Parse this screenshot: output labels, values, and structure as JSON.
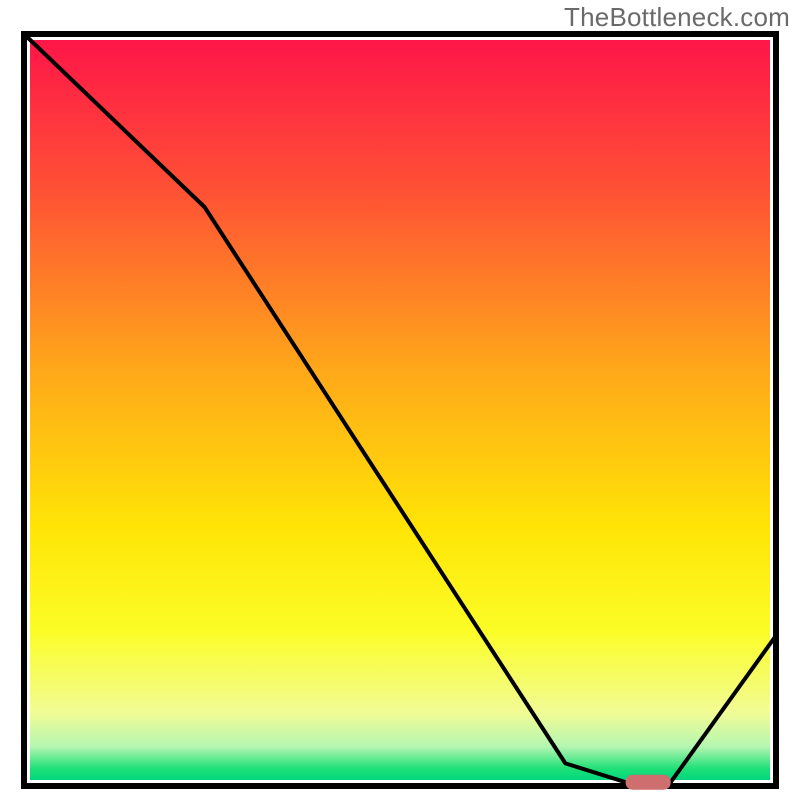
{
  "watermark": "TheBottleneck.com",
  "chart_data": {
    "type": "line",
    "title": "",
    "xlabel": "",
    "ylabel": "",
    "xlim": [
      0,
      100
    ],
    "ylim": [
      0,
      100
    ],
    "grid": false,
    "legend": false,
    "series": [
      {
        "name": "curve",
        "x": [
          0,
          24,
          72,
          80,
          86,
          100
        ],
        "values": [
          100,
          77,
          3,
          0.5,
          0.5,
          20
        ]
      }
    ],
    "marker": {
      "x_start": 80,
      "x_end": 86,
      "y": 0.5,
      "color": "#cf6e6e"
    },
    "background_gradient": {
      "stops": [
        {
          "offset": 0.0,
          "color": "#fe1649"
        },
        {
          "offset": 0.2,
          "color": "#ff5035"
        },
        {
          "offset": 0.45,
          "color": "#ffa919"
        },
        {
          "offset": 0.66,
          "color": "#ffe506"
        },
        {
          "offset": 0.8,
          "color": "#fbfd27"
        },
        {
          "offset": 0.91,
          "color": "#f1fc96"
        },
        {
          "offset": 0.955,
          "color": "#b4f6b1"
        },
        {
          "offset": 0.985,
          "color": "#1de076"
        },
        {
          "offset": 1.0,
          "color": "#00d67f"
        }
      ]
    }
  }
}
